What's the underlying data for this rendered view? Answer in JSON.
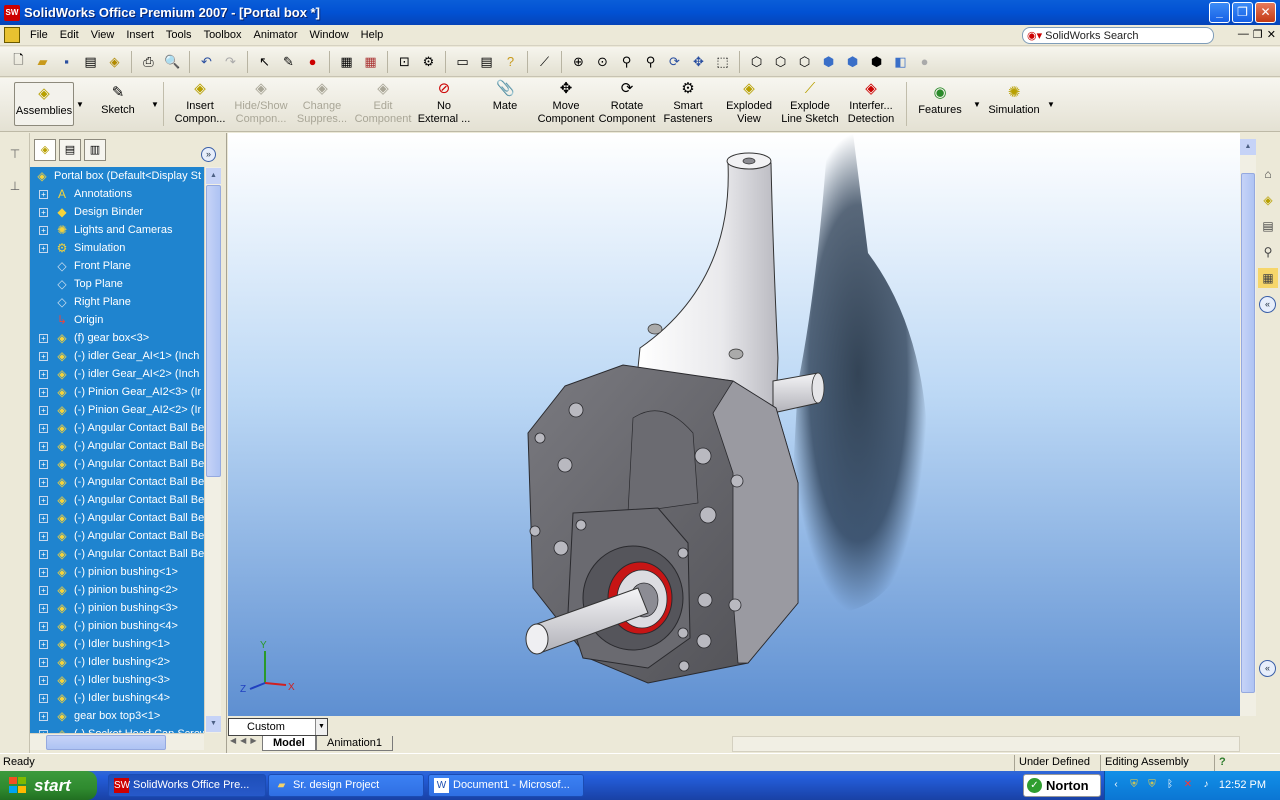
{
  "window": {
    "title": "SolidWorks Office Premium 2007 - [Portal box *]",
    "app_icon": "sw-logo-icon"
  },
  "menu": {
    "items": [
      "File",
      "Edit",
      "View",
      "Insert",
      "Tools",
      "Toolbox",
      "Animator",
      "Window",
      "Help"
    ],
    "search_label": "SolidWorks Search"
  },
  "command_manager": {
    "assemblies": "Assemblies",
    "sketch": "Sketch",
    "buttons": [
      {
        "l1": "Insert",
        "l2": "Compon...",
        "icon": "insert-component-icon",
        "enabled": true
      },
      {
        "l1": "Hide/Show",
        "l2": "Compon...",
        "icon": "hide-show-icon",
        "enabled": false
      },
      {
        "l1": "Change",
        "l2": "Suppres...",
        "icon": "change-suppression-icon",
        "enabled": false
      },
      {
        "l1": "Edit",
        "l2": "Component",
        "icon": "edit-component-icon",
        "enabled": false
      },
      {
        "l1": "No",
        "l2": "External ...",
        "icon": "no-external-icon",
        "enabled": true
      },
      {
        "l1": "Mate",
        "l2": "",
        "icon": "mate-icon",
        "enabled": true
      },
      {
        "l1": "Move",
        "l2": "Component",
        "icon": "move-component-icon",
        "enabled": true
      },
      {
        "l1": "Rotate",
        "l2": "Component",
        "icon": "rotate-component-icon",
        "enabled": true
      },
      {
        "l1": "Smart",
        "l2": "Fasteners",
        "icon": "smart-fasteners-icon",
        "enabled": true
      },
      {
        "l1": "Exploded",
        "l2": "View",
        "icon": "exploded-view-icon",
        "enabled": true
      },
      {
        "l1": "Explode",
        "l2": "Line Sketch",
        "icon": "explode-line-sketch-icon",
        "enabled": true
      },
      {
        "l1": "Interfer...",
        "l2": "Detection",
        "icon": "interference-detection-icon",
        "enabled": true
      }
    ],
    "features": "Features",
    "simulation": "Simulation"
  },
  "feature_tree": {
    "root": "Portal box  (Default<Display St",
    "items": [
      {
        "label": "Annotations",
        "icon": "annotations-icon",
        "expandable": true
      },
      {
        "label": "Design Binder",
        "icon": "design-binder-icon",
        "expandable": true
      },
      {
        "label": "Lights and Cameras",
        "icon": "lights-cameras-icon",
        "expandable": true
      },
      {
        "label": "Simulation",
        "icon": "simulation-icon",
        "expandable": true
      },
      {
        "label": "Front Plane",
        "icon": "plane-icon",
        "expandable": false
      },
      {
        "label": "Top Plane",
        "icon": "plane-icon",
        "expandable": false
      },
      {
        "label": "Right Plane",
        "icon": "plane-icon",
        "expandable": false
      },
      {
        "label": "Origin",
        "icon": "origin-icon",
        "expandable": false
      },
      {
        "label": "(f) gear box<3>",
        "icon": "part-icon",
        "expandable": true
      },
      {
        "label": "(-) idler Gear_AI<1> (Inch",
        "icon": "part-icon",
        "expandable": true
      },
      {
        "label": "(-) idler Gear_AI<2> (Inch",
        "icon": "part-icon",
        "expandable": true
      },
      {
        "label": "(-) Pinion Gear_AI2<3> (Ir",
        "icon": "part-icon",
        "expandable": true
      },
      {
        "label": "(-) Pinion Gear_AI2<2> (Ir",
        "icon": "part-icon",
        "expandable": true
      },
      {
        "label": "(-) Angular Contact Ball Bea",
        "icon": "part-icon",
        "expandable": true
      },
      {
        "label": "(-) Angular Contact Ball Bea",
        "icon": "part-icon",
        "expandable": true
      },
      {
        "label": "(-) Angular Contact Ball Bea",
        "icon": "part-icon",
        "expandable": true
      },
      {
        "label": "(-) Angular Contact Ball Bea",
        "icon": "part-icon",
        "expandable": true
      },
      {
        "label": "(-) Angular Contact Ball Bea",
        "icon": "part-icon",
        "expandable": true
      },
      {
        "label": "(-) Angular Contact Ball Bea",
        "icon": "part-icon",
        "expandable": true
      },
      {
        "label": "(-) Angular Contact Ball Bea",
        "icon": "part-icon",
        "expandable": true
      },
      {
        "label": "(-) Angular Contact Ball Bea",
        "icon": "part-icon",
        "expandable": true
      },
      {
        "label": "(-) pinion bushing<1>",
        "icon": "part-icon",
        "expandable": true
      },
      {
        "label": "(-) pinion bushing<2>",
        "icon": "part-icon",
        "expandable": true
      },
      {
        "label": "(-) pinion bushing<3>",
        "icon": "part-icon",
        "expandable": true
      },
      {
        "label": "(-) pinion bushing<4>",
        "icon": "part-icon",
        "expandable": true
      },
      {
        "label": "(-) Idler bushing<1>",
        "icon": "part-icon",
        "expandable": true
      },
      {
        "label": "(-) Idler bushing<2>",
        "icon": "part-icon",
        "expandable": true
      },
      {
        "label": "(-) Idler bushing<3>",
        "icon": "part-icon",
        "expandable": true
      },
      {
        "label": "(-) Idler bushing<4>",
        "icon": "part-icon",
        "expandable": true
      },
      {
        "label": "gear box top3<1>",
        "icon": "part-icon",
        "expandable": true
      },
      {
        "label": "(-) Socket Head Cap Screw",
        "icon": "part-icon",
        "expandable": true
      }
    ]
  },
  "viewport": {
    "triad": {
      "x": "X",
      "y": "Y",
      "z": "Z"
    }
  },
  "view_bottom": {
    "display_state": "Custom",
    "tabs": [
      "Model",
      "Animation1"
    ]
  },
  "status": {
    "left": "Ready",
    "mid": "Under Defined",
    "right": "Editing Assembly",
    "help": "?"
  },
  "taskbar": {
    "start": "start",
    "tasks": [
      {
        "label": "SolidWorks Office Pre...",
        "icon": "solidworks-icon",
        "active": true
      },
      {
        "label": "Sr. design Project",
        "icon": "folder-icon",
        "active": false
      },
      {
        "label": "Document1 - Microsof...",
        "icon": "word-icon",
        "active": false
      }
    ],
    "norton": "Norton",
    "clock": "12:52 PM"
  },
  "colors": {
    "tree_bg": "#1f84cf",
    "housing": "#5f5f63",
    "cap": "#efefef",
    "seal": "#d81414"
  }
}
